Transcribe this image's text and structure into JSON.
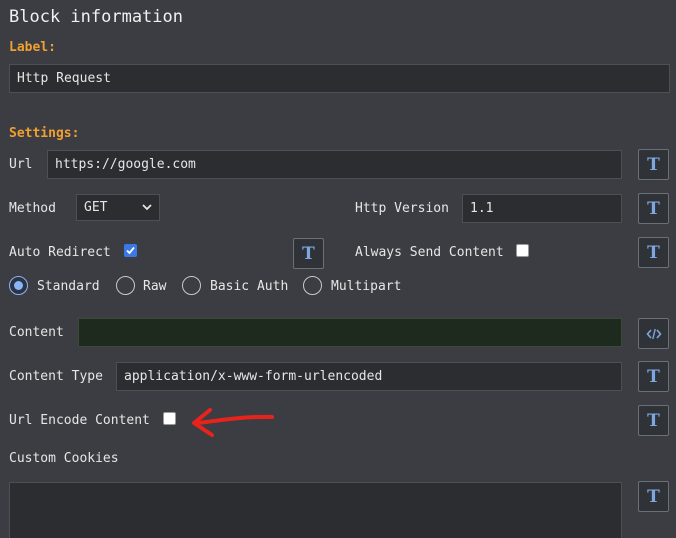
{
  "panel": {
    "title": "Block information",
    "label_section": "Label:",
    "label_value": "Http Request",
    "settings_section": "Settings:"
  },
  "fields": {
    "url_label": "Url",
    "url_value": "https://google.com",
    "method_label": "Method",
    "method_value": "GET",
    "http_version_label": "Http Version",
    "http_version_value": "1.1",
    "auto_redirect_label": "Auto Redirect",
    "auto_redirect_checked": true,
    "always_send_content_label": "Always Send Content",
    "always_send_content_checked": false,
    "content_label": "Content",
    "content_value": "",
    "content_type_label": "Content Type",
    "content_type_value": "application/x-www-form-urlencoded",
    "url_encode_content_label": "Url Encode Content",
    "url_encode_content_checked": false,
    "custom_cookies_label": "Custom Cookies",
    "custom_cookies_value": ""
  },
  "auth_options": {
    "selected": "Standard",
    "options": [
      "Standard",
      "Raw",
      "Basic Auth",
      "Multipart"
    ]
  },
  "buttons": {
    "template_button_glyph": "T",
    "code_button_glyph": "</>"
  },
  "annotation": {
    "arrow_color": "#e8231c"
  },
  "colors": {
    "background": "#3b3d43",
    "section_label": "#f0a030",
    "input_background": "#2b2d31",
    "content_input_background": "#1f2a1e",
    "button_icon": "#7ea7e0",
    "checkbox_checked": "#3b78e7"
  }
}
